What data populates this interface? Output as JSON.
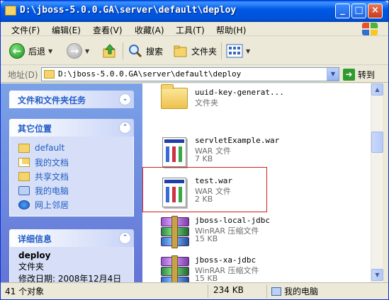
{
  "window": {
    "title": "D:\\jboss-5.0.0.GA\\server\\default\\deploy",
    "min_glyph": "_",
    "max_glyph": "□",
    "close_glyph": "×"
  },
  "menu": [
    "文件(F)",
    "编辑(E)",
    "查看(V)",
    "收藏(A)",
    "工具(T)",
    "帮助(H)"
  ],
  "toolbar": {
    "back_label": "后退",
    "search_label": "搜索",
    "folders_label": "文件夹"
  },
  "address": {
    "label": "地址(D)",
    "value": "D:\\jboss-5.0.0.GA\\server\\default\\deploy",
    "go_label": "转到"
  },
  "left_panel": {
    "tasks_title": "文件和文件夹任务",
    "places_title": "其它位置",
    "places": [
      {
        "label": "default",
        "icon": "folder-icon"
      },
      {
        "label": "我的文档",
        "icon": "documents-icon"
      },
      {
        "label": "共享文档",
        "icon": "folder-icon"
      },
      {
        "label": "我的电脑",
        "icon": "computer-icon"
      },
      {
        "label": "网上邻居",
        "icon": "network-icon"
      }
    ],
    "details_title": "详细信息",
    "details_name": "deploy",
    "details_type": "文件夹",
    "details_modified": "修改日期: 2008年12月4日"
  },
  "files": [
    {
      "name": "uuid-key-generat...",
      "type": "文件夹",
      "size": "",
      "icon": "folder-icon"
    },
    {
      "name": "servletExample.war",
      "type": "WAR 文件",
      "size": "7 KB",
      "icon": "war-file-icon"
    },
    {
      "name": "test.war",
      "type": "WAR 文件",
      "size": "2 KB",
      "icon": "war-file-icon"
    },
    {
      "name": "jboss-local-jdbc",
      "type": "WinRAR 压缩文件",
      "size": "15 KB",
      "icon": "rar-archive-icon"
    },
    {
      "name": "jboss-xa-jdbc",
      "type": "WinRAR 压缩文件",
      "size": "15 KB",
      "icon": "rar-archive-icon"
    }
  ],
  "status": {
    "count": "41 个对象",
    "size": "234 KB",
    "location": "我的电脑"
  },
  "colors": {
    "titlebar": "#0058e6",
    "panel_link": "#215dc6",
    "highlight_box": "#d21f1f"
  }
}
